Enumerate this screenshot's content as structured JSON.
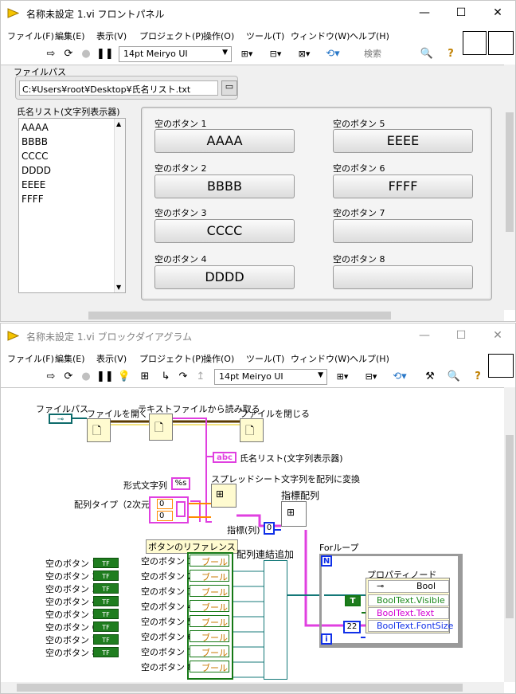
{
  "front": {
    "title": "名称未設定 1.vi フロントパネル",
    "menu": [
      "ファイル(F)",
      "編集(E)",
      "表示(V)",
      "プロジェクト(P)",
      "操作(O)",
      "ツール(T)",
      "ウィンドウ(W)",
      "ヘルプ(H)"
    ],
    "font": "14pt Meiryo UI",
    "search_placeholder": "検索",
    "path_label": "ファイルパス",
    "path_value": "C:¥Users¥root¥Desktop¥氏名リスト.txt",
    "list_label": "氏名リスト(文字列表示器)",
    "list_items": [
      "AAAA",
      "BBBB",
      "CCCC",
      "DDDD",
      "EEEE",
      "FFFF"
    ],
    "buttons": [
      {
        "label": "空のボタン 1",
        "text": "AAAA"
      },
      {
        "label": "空のボタン 2",
        "text": "BBBB"
      },
      {
        "label": "空のボタン 3",
        "text": "CCCC"
      },
      {
        "label": "空のボタン 4",
        "text": "DDDD"
      },
      {
        "label": "空のボタン 5",
        "text": "EEEE"
      },
      {
        "label": "空のボタン 6",
        "text": "FFFF"
      },
      {
        "label": "空のボタン 7",
        "text": ""
      },
      {
        "label": "空のボタン 8",
        "text": ""
      }
    ]
  },
  "block": {
    "title": "名称未設定 1.vi ブロックダイアグラム",
    "menu": [
      "ファイル(F)",
      "編集(E)",
      "表示(V)",
      "プロジェクト(P)",
      "操作(O)",
      "ツール(T)",
      "ウィンドウ(W)",
      "ヘルプ(H)"
    ],
    "font": "14pt Meiryo UI",
    "labels": {
      "file_path": "ファイルパス",
      "open_file": "ファイルを開く",
      "read_text": "テキストファイルから読み取る",
      "close_file": "ファイルを閉じる",
      "name_list": "氏名リスト(文字列表示器)",
      "format_string": "形式文字列",
      "format_value": "%s",
      "array_type": "配列タイプ（2次元）",
      "array_zero_1": "0",
      "array_zero_2": "0",
      "spreadsheet": "スプレッドシート文字列を配列に変換",
      "index_array": "指標配列",
      "index_col": "指標(列)",
      "index_value": "0",
      "abc": "abc",
      "refs_title": "ボタンのリファレンス",
      "build_array": "配列連結追加",
      "for_loop": "Forループ",
      "loop_n": "N",
      "loop_i": "i",
      "prop_node": "プロパティノード",
      "prop_class": "Bool",
      "prop_visible": "BoolText.Visible",
      "prop_text": "BoolText.Text",
      "prop_fontsize": "BoolText.FontSize",
      "true_const": "T",
      "fontsize_const": "22",
      "tf": "TF",
      "ref_suffix": "ブール"
    },
    "controls": [
      "空のボタン 1",
      "空のボタン 2",
      "空のボタン 3",
      "空のボタン 4",
      "空のボタン 5",
      "空のボタン 6",
      "空のボタン 7",
      "空のボタン 8"
    ]
  }
}
